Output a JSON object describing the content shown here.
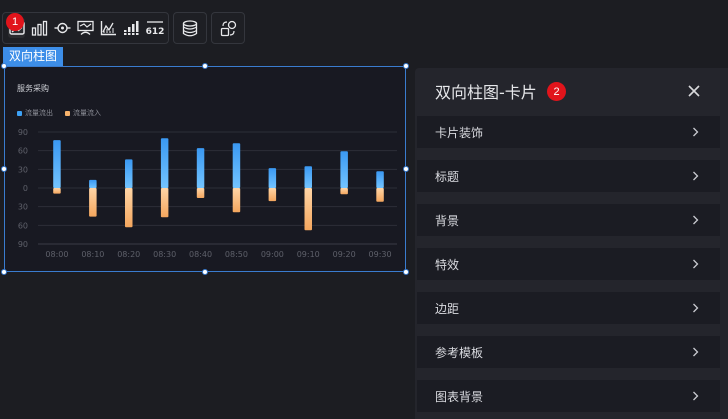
{
  "toolbar": {
    "badge": "1",
    "groups": [
      [
        "picture-card-icon",
        "bar-chart-icon",
        "radar-target-icon",
        "map-route-icon",
        "axis-line-icon",
        "step-bars-icon",
        "number-612-icon"
      ],
      [
        "database-icon"
      ],
      [
        "shape-swap-icon"
      ]
    ],
    "number_icon_text": "612"
  },
  "component": {
    "tag": "双向柱图"
  },
  "chart_data": {
    "type": "bar",
    "title": "服务采购",
    "categories": [
      "08:00",
      "08:10",
      "08:20",
      "08:30",
      "08:40",
      "08:50",
      "09:00",
      "09:10",
      "09:20",
      "09:30"
    ],
    "series": [
      {
        "name": "流量流出",
        "values": [
          77,
          13,
          46,
          80,
          64,
          72,
          32,
          35,
          59,
          27
        ],
        "color": "#3da1f5"
      },
      {
        "name": "流量流入",
        "values": [
          -9,
          -46,
          -63,
          -47,
          -16,
          -39,
          -21,
          -68,
          -10,
          -22
        ],
        "color": "#f6b26b"
      }
    ],
    "y_ticks": [
      "90",
      "60",
      "30",
      "0",
      "30",
      "60",
      "90"
    ],
    "ylim": [
      -90,
      90
    ],
    "grid": true,
    "legend": "top-left"
  },
  "panel": {
    "title": "双向柱图-卡片",
    "badge": "2",
    "close_icon": "close-icon",
    "sections": [
      "卡片装饰",
      "标题",
      "背景",
      "特效",
      "边距",
      "参考模板",
      "图表背景"
    ]
  },
  "colors": {
    "accent": "#3d8ee8",
    "badge": "#e1141b",
    "panel_bg": "#24252c",
    "section_bg": "#1b1c23"
  }
}
